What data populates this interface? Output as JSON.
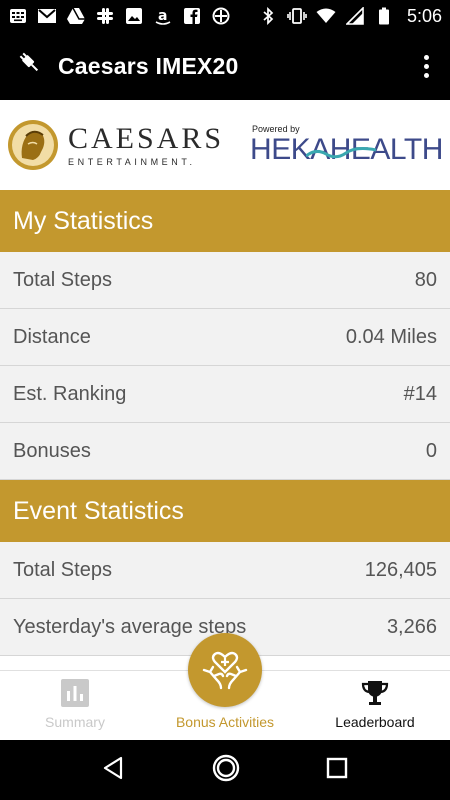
{
  "status_bar": {
    "time": "5:06",
    "left_icons": [
      "grid-icon",
      "mail-icon",
      "drive-icon",
      "slack-icon",
      "image-icon",
      "amazon-icon",
      "facebook-icon",
      "slack-icon"
    ],
    "right_icons": [
      "bluetooth-icon",
      "vibrate-icon",
      "wifi-icon",
      "signal-icon",
      "battery-icon"
    ]
  },
  "app_bar": {
    "title": "Caesars IMEX20",
    "icon": "plug-icon",
    "menu_icon": "overflow-menu-icon"
  },
  "banner": {
    "caesars_name": "CAESARS",
    "caesars_sub": "ENTERTAINMENT.",
    "powered_by": "Powered by",
    "heka_name": "HEKAHEALTH"
  },
  "my_statistics": {
    "title": "My Statistics",
    "rows": [
      {
        "label": "Total Steps",
        "value": "80"
      },
      {
        "label": "Distance",
        "value": "0.04 Miles"
      },
      {
        "label": "Est. Ranking",
        "value": "#14"
      },
      {
        "label": "Bonuses",
        "value": "0"
      }
    ]
  },
  "event_statistics": {
    "title": "Event Statistics",
    "rows": [
      {
        "label": "Total Steps",
        "value": "126,405"
      },
      {
        "label": "Yesterday's average steps",
        "value": "3,266"
      }
    ]
  },
  "bottom_nav": {
    "items": [
      {
        "label": "Summary",
        "icon": "bar-chart-icon"
      },
      {
        "label": "Bonus Activities",
        "icon": "hands-heart-icon"
      },
      {
        "label": "Leaderboard",
        "icon": "trophy-icon"
      }
    ]
  },
  "colors": {
    "gold": "#c3982e",
    "row_bg": "#f2f2f2",
    "heka_blue": "#3d4a8a",
    "heka_teal": "#3aa8b0"
  }
}
